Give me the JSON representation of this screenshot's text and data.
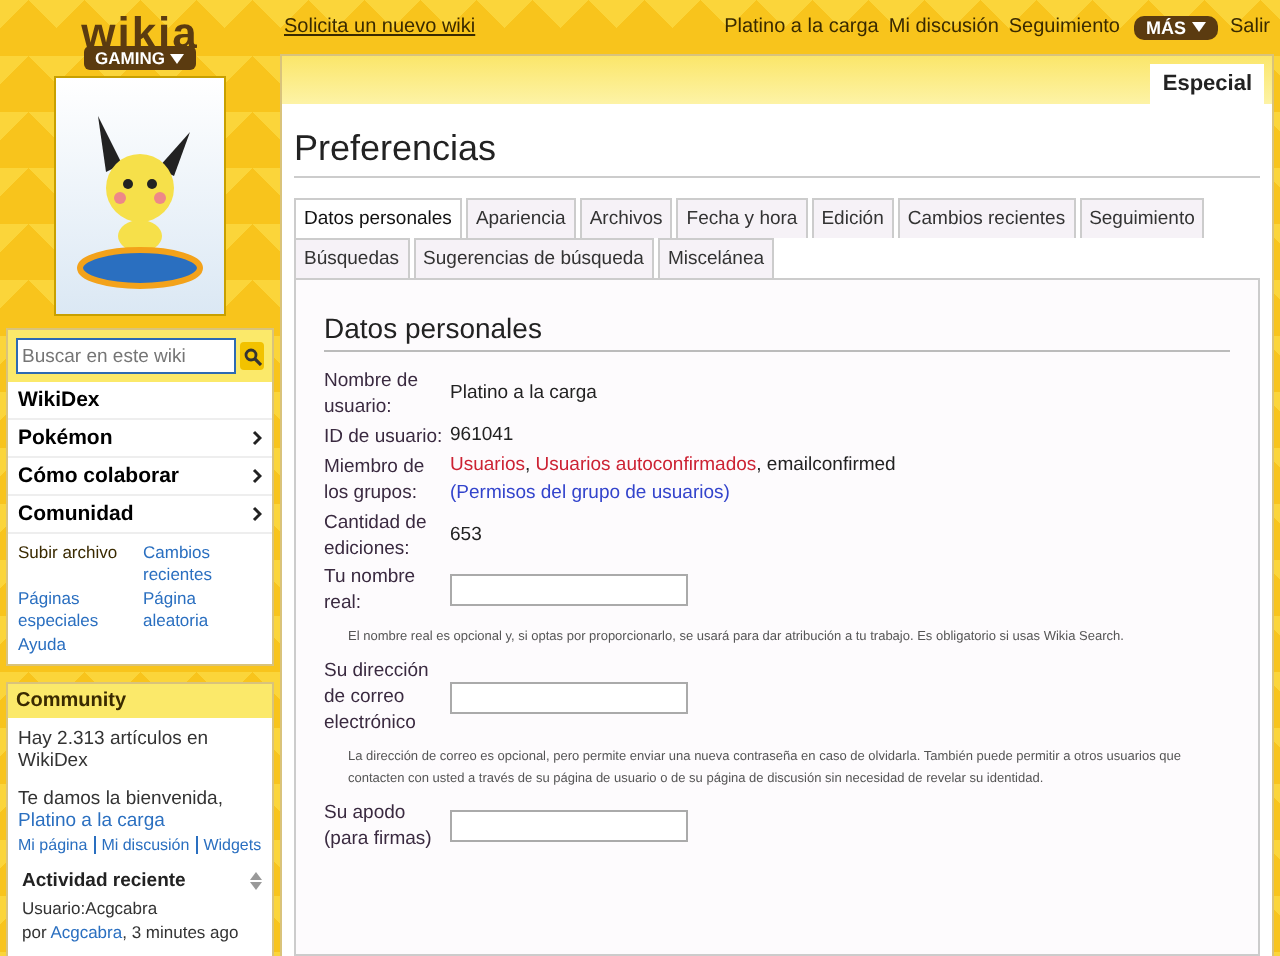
{
  "header": {
    "logo": "wikia",
    "hub": "GAMING",
    "request_link": "Solicita un nuevo wiki",
    "user_links": [
      "Platino a la carga",
      "Mi discusión",
      "Seguimiento"
    ],
    "more": "MÁS",
    "logout": "Salir"
  },
  "sidebar": {
    "search": {
      "placeholder": "Buscar en este wiki"
    },
    "wiki_name": "WikiDex",
    "menu": [
      {
        "label": "Pokémon"
      },
      {
        "label": "Cómo colaborar"
      },
      {
        "label": "Comunidad"
      }
    ],
    "links": [
      {
        "label": "Subir archivo",
        "kind": "plain"
      },
      {
        "label": "Cambios recientes",
        "kind": "link"
      },
      {
        "label": "Páginas especiales",
        "kind": "link"
      },
      {
        "label": "Página aleatoria",
        "kind": "link"
      },
      {
        "label": "Ayuda",
        "kind": "link"
      }
    ]
  },
  "community": {
    "title": "Community",
    "stats": "Hay 2.313 artículos en WikiDex",
    "welcome": "Te damos la bienvenida,",
    "user": "Platino a la carga",
    "user_links": [
      "Mi página",
      "Mi discusión",
      "Widgets"
    ],
    "activity_title": "Actividad reciente",
    "activity_page": "Usuario:Acgcabra",
    "activity_by": "por",
    "activity_user": "Acgcabra",
    "activity_time": ", 3 minutes ago"
  },
  "page": {
    "namespace_tab": "Especial",
    "title": "Preferencias",
    "tabs": [
      {
        "label": "Datos personales",
        "selected": true
      },
      {
        "label": "Apariencia",
        "selected": false
      },
      {
        "label": "Archivos",
        "selected": false
      },
      {
        "label": "Fecha y hora",
        "selected": false
      },
      {
        "label": "Edición",
        "selected": false
      },
      {
        "label": "Cambios recientes",
        "selected": false
      },
      {
        "label": "Seguimiento",
        "selected": false
      },
      {
        "label": "Búsquedas",
        "selected": false
      },
      {
        "label": "Sugerencias de búsqueda",
        "selected": false
      },
      {
        "label": "Miscelánea",
        "selected": false
      }
    ],
    "section": "Datos personales",
    "rows": [
      {
        "kind": "value",
        "label": "Nombre de usuario:",
        "value": "Platino a la carga"
      },
      {
        "kind": "value",
        "label": "ID de usuario:",
        "value": "961041"
      },
      {
        "kind": "groups",
        "label": "Miembro de los grupos:",
        "groups": [
          {
            "name": "Usuarios",
            "kind": "redlink"
          },
          {
            "name": "Usuarios autoconfirmados",
            "kind": "redlink"
          },
          {
            "name": "emailconfirmed",
            "kind": "text"
          }
        ],
        "separator": ",",
        "permissions_link": "(Permisos del grupo de usuarios)"
      },
      {
        "kind": "value",
        "label": "Cantidad de ediciones:",
        "value": "653"
      },
      {
        "kind": "input",
        "label": "Tu nombre real:",
        "help": "El nombre real es opcional y, si optas por proporcionarlo, se usará para dar atribución a tu trabajo. Es obligatorio si usas Wikia Search."
      },
      {
        "kind": "input",
        "label": "Su dirección de correo electrónico",
        "help": "La dirección de correo es opcional, pero permite enviar una nueva contraseña en caso de olvidarla. También puede permitir a otros usuarios que contacten con usted a través de su página de usuario o de su página de discusión sin necesidad de revelar su identidad."
      },
      {
        "kind": "input",
        "label": "Su apodo (para firmas)"
      }
    ]
  }
}
